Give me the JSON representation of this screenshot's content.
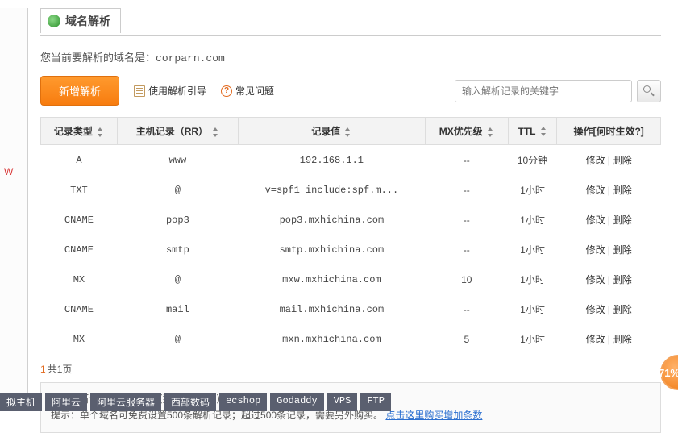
{
  "left_label": "W",
  "page_title": "域名解析",
  "subtitle_prefix": "您当前要解析的域名是：",
  "domain": "corparn.com",
  "toolbar": {
    "add_label": "新增解析",
    "guide_label": "使用解析引导",
    "faq_label": "常见问题"
  },
  "search": {
    "placeholder": "输入解析记录的关键字"
  },
  "columns": {
    "type": "记录类型",
    "host": "主机记录（RR）",
    "value": "记录值",
    "mx": "MX优先级",
    "ttl": "TTL",
    "ops": "操作[何时生效?]"
  },
  "ops": {
    "edit": "修改",
    "del": "删除"
  },
  "records": [
    {
      "type": "A",
      "host": "www",
      "value": "192.168.1.1",
      "mx": "--",
      "ttl": "10分钟"
    },
    {
      "type": "TXT",
      "host": "@",
      "value": "v=spf1 include:spf.m...",
      "mx": "--",
      "ttl": "1小时"
    },
    {
      "type": "CNAME",
      "host": "pop3",
      "value": "pop3.mxhichina.com",
      "mx": "--",
      "ttl": "1小时"
    },
    {
      "type": "CNAME",
      "host": "smtp",
      "value": "smtp.mxhichina.com",
      "mx": "--",
      "ttl": "1小时"
    },
    {
      "type": "MX",
      "host": "@",
      "value": "mxw.mxhichina.com",
      "mx": "10",
      "ttl": "1小时"
    },
    {
      "type": "CNAME",
      "host": "mail",
      "value": "mail.mxhichina.com",
      "mx": "--",
      "ttl": "1小时"
    },
    {
      "type": "MX",
      "host": "@",
      "value": "mxn.mxhichina.com",
      "mx": "5",
      "ttl": "1小时"
    }
  ],
  "pager": {
    "num": "1",
    "text": "共1页"
  },
  "infobox": {
    "line1": "您的解析记录已使用0条（剩余7条可用）。",
    "line2_a": "提示：单个域名可免费设置500条解析记录；超过500条记录，需要另外购买。",
    "line2_link": "点击这里购买增加条数"
  },
  "tags": [
    "拟主机",
    "阿里云",
    "阿里云服务器",
    "西部数码",
    "ecshop",
    "Godaddy",
    "VPS",
    "FTP"
  ],
  "badge": "71%"
}
